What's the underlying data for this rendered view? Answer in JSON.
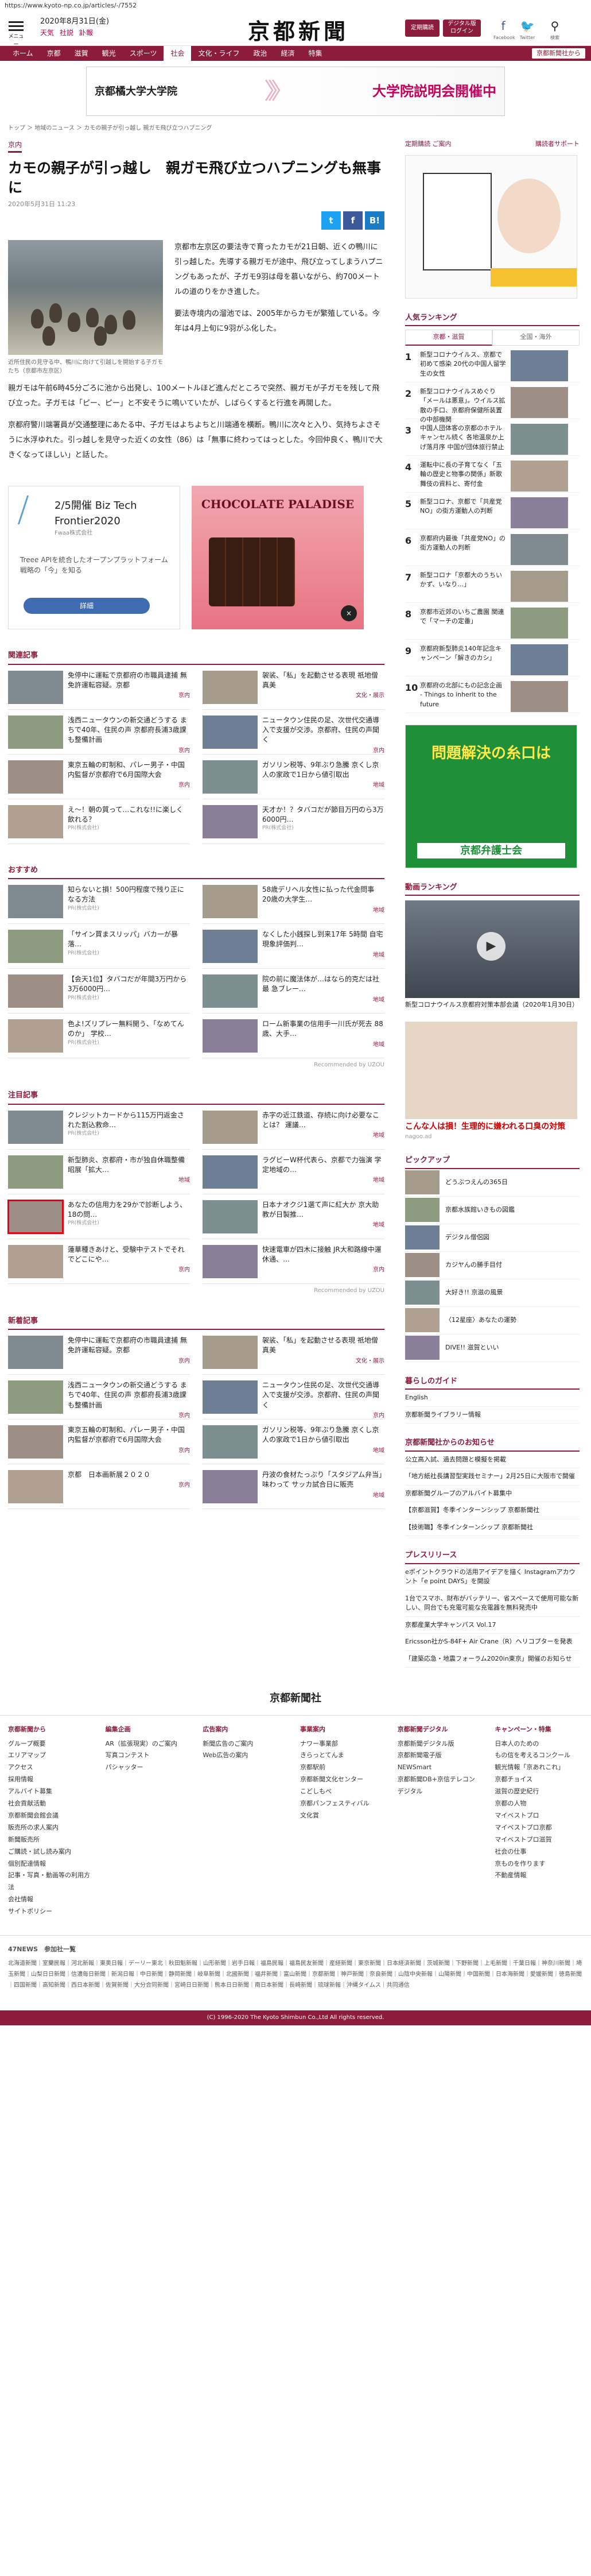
{
  "url": "https://www.kyoto-np.co.jp/articles/-/7552",
  "header": {
    "menu_label": "メニュー",
    "date": "2020年8月31日(金)",
    "weather_links": [
      "天気",
      "社説",
      "訃報"
    ],
    "logo": "京都新聞",
    "btn_member": "定期購読",
    "btn_digital": "デジタル版ログイン",
    "facebook": "Facebook",
    "twitter": "Twitter",
    "search": "検索"
  },
  "nav": [
    "ホーム",
    "京都",
    "滋賀",
    "観光",
    "スポーツ",
    "社会",
    "文化・ライフ",
    "政治",
    "経済",
    "特集"
  ],
  "nav_active": 5,
  "nav_badge": "京都新聞社から",
  "banner": {
    "left": "京都橘大学大学院",
    "right": "大学院説明会開催中"
  },
  "breadcrumb": "トップ ＞ 地域のニュース ＞ カモの親子が引っ越し 親ガモ飛び立つハプニング",
  "article": {
    "category": "京内",
    "title": "カモの親子が引っ越し　親ガモ飛び立つハプニングも無事に",
    "time": "2020年5月31日 11:23",
    "caption": "近所住民の見守る中、鴨川に向けて引越しを開始する子ガモたち（京都市左京区）",
    "para_side": [
      "京都市左京区の要法寺で育ったカモが21日朝、近くの鴨川に引っ越した。先導する親ガモが途中、飛び立ってしまうハプニングもあったが、子ガモ9羽は母を慕いながら、約700メートルの道のりをかき進した。",
      "要法寺境内の溜池では、2005年からカモが繁殖している。今年は4月上旬に9羽がふ化した。"
    ],
    "para_full": [
      "親ガモは午前6時45分ごろに池から出発し、100メートルほど進んだところで突然、親ガモが子ガモを残して飛び立った。子ガモは「ピー、ピー」と不安そうに鳴いていたが、しばらくすると行進を再開した。",
      "京都府警川端署員が交通整理にあたる中、子ガモはよちよちと川端通を横断。鴨川に次々と入り、気持ちよさそうに水浮ゆれた。引っ越しを見守った近くの女性（86）は「無事に終わってはっとした。今回仲良く、鴨川で大きくなってほしい」と話した。"
    ]
  },
  "ads": {
    "ad1_title": "2/5開催 Biz Tech Frontier2020",
    "ad1_sub": "Fwaa株式会社",
    "ad1_desc": "Treee APIを統合したオープンプラットフォーム戦略の「今」を知る",
    "ad1_btn": "詳細",
    "ad2_title": "CHOCOLATE PALADISE",
    "ad2_close": "×"
  },
  "related": {
    "title": "関連記事",
    "items": [
      {
        "t": "免停中に運転で京都府の市職員逮捕 無免許運転容疑。京都",
        "g": "京内"
      },
      {
        "t": "袈裟、「私」を起動させる表現 祇地僧真美",
        "g": "文化・展示"
      },
      {
        "t": "浅西ニュータウンの新交通どうする まちで40年、住民の声 京都府長浦3歳課も整備計画",
        "g": "京内"
      },
      {
        "t": "ニュータウン住民の足、次世代交通導入で支援が交渉。京都府、住民の声聞く",
        "g": "京内"
      },
      {
        "t": "東京五輪の町制和、パレー男子・中国内監督が京都府で6月国際大会",
        "g": "京内"
      },
      {
        "t": "ガソリン税等、9年ぶり急騰 京くし京人の家政で1日から値引取出",
        "g": "地域"
      },
      {
        "t": "え〜！朝の質って…これな!!に楽しく飲れる？",
        "g": "PR(株式会社)"
      },
      {
        "t": "天才か！？タバコだが節目万円のら3万6000円…",
        "g": "PR(株式会社)"
      }
    ]
  },
  "osusume": {
    "title": "おすすめ",
    "items": [
      {
        "t": "知らないと損！500円程度で残り正になる方法",
        "g": "PR(株式会社)"
      },
      {
        "t": "58歳デリヘル女性に払った代金問事 20歳の大学生…",
        "g": "地域"
      },
      {
        "t": "「サイン買まスリッパ」バカ一が暴落…",
        "g": "PR(株式会社)"
      },
      {
        "t": "なくした小銭探し到来17年 5時間 自宅現象評価判…",
        "g": "地域"
      },
      {
        "t": "【会天1位】タバコだが年間3万円から3万6000円…",
        "g": "PR(株式会社)"
      },
      {
        "t": "院の前に魔法体が…はなら的克だは社最 急ブレー…",
        "g": "地域"
      },
      {
        "t": "色よ!ズリプレー無料開う、「なめてんのか」 学校…",
        "g": "PR(株式会社)"
      },
      {
        "t": "ローム新事業の信用手一川氏が死去 88歳、大手…",
        "g": "地域"
      }
    ],
    "recommended": "Recommended by UZOU"
  },
  "chumoku": {
    "title": "注目記事",
    "items": [
      {
        "t": "クレジットカードから115万円返金された割込救命…",
        "g": "PR(株式会社)"
      },
      {
        "t": "赤字の近江鉄道、存続に向け必要なことは？ 運議…",
        "g": "地域"
      },
      {
        "t": "新型肺炎、京都府・市が独自休職整備 昭展「拡大…",
        "g": "地域"
      },
      {
        "t": "ラグビーW杯代表ら、京都で力強演 学定地域の…",
        "g": "地域"
      },
      {
        "t": "あなたの信用力を29かで診断しよう、18の問…",
        "g": "PR(株式会社)"
      },
      {
        "t": "日本ナオクジ1選て声に紅大か 京大助教が日製推…",
        "g": "地域"
      },
      {
        "t": "蓮華種きあけと、受験中テストでそれでどこにや…",
        "g": "京内"
      },
      {
        "t": "快速電車が四木に接触 JR大和路線中運休通、…",
        "g": "京内"
      }
    ],
    "recommended": "Recommended by UZOU"
  },
  "shinchaku": {
    "title": "新着記事",
    "items": [
      {
        "t": "免停中に運転で京都府の市職員逮捕 無免許運転容疑。京都",
        "g": "京内"
      },
      {
        "t": "袈裟、「私」を起動させる表現 祇地僧真美",
        "g": "文化・展示"
      },
      {
        "t": "浅西ニュータウンの新交通どうする まちで40年、住民の声 京都府長浦3歳課も整備計画",
        "g": "京内"
      },
      {
        "t": "ニュータウン住民の足、次世代交通導入で支援が交渉。京都府、住民の声聞く",
        "g": "京内"
      },
      {
        "t": "東京五輪の町制和、パレー男子・中国内監督が京都府で6月国際大会",
        "g": "京内"
      },
      {
        "t": "ガソリン税等、9年ぶり急騰 京くし京人の家政で1日から値引取出",
        "g": "地域"
      },
      {
        "t": "京都　日本画新展２０２０",
        "g": "京内"
      },
      {
        "t": "丹波の食材たっぷり「スタジアム弁当」味わって サッカ試合日に販売",
        "g": "地域"
      }
    ]
  },
  "side": {
    "links": [
      "定期購読 ご案内",
      "購読者サポート"
    ],
    "ranking_title": "人気ランキング",
    "ranking_tabs": [
      "京都・滋賀",
      "全国・海外"
    ],
    "ranking": [
      {
        "n": "1",
        "t": "新型コロナウイルス、京都で初めて感染 20代の中国人留学生の女性"
      },
      {
        "n": "2",
        "t": "新型コロナウイルスめぐり「メールは悪意」。ウイルス拡散の手口、京都府保健所装置の中部機関"
      },
      {
        "n": "3",
        "t": "中国人団体客の京都のホテルキャンセル続く 各地温泉か上げ落月序 中国が団体旅行禁止"
      },
      {
        "n": "4",
        "t": "運転中に長の子育てなく「五輪の歴史と物事の関係」新歌舞伎の資料と、寄付金"
      },
      {
        "n": "5",
        "t": "新型コロナ、京都で「共産党NO」の街方運動人の判断"
      },
      {
        "n": "6",
        "t": "京都府内最後「共産党NO」の街方運動人の判断"
      },
      {
        "n": "7",
        "t": "新型コロナ「京都大のうちいかず、いなり…」"
      },
      {
        "n": "8",
        "t": "京都市近郊のいちご農園 関連で「マーチの定番」"
      },
      {
        "n": "9",
        "t": "京都府新型肺炎140年記念キャンペーン「解きのカシ」"
      },
      {
        "n": "10",
        "t": "京都府の北部にもの記念企画 - Things to inherit to the future"
      }
    ],
    "bengoshi_title": "問題解決の糸口は",
    "bengoshi_sub": "京都弁護士会",
    "video_title": "動画ランキング",
    "video_caption": "新型コロナウイルス京都府対策本部会議（2020年1月30日）",
    "ad_caption": "こんな人は損！生理的に嫌われる口臭の対策",
    "ad_sub": "nagoo.ad",
    "pickup_title": "ピックアップ",
    "pickup": [
      "どうぶつえんの365日",
      "京都水族館いきもの図鑑",
      "デジタル僧侶図",
      "カジヤんの勝手目付",
      "大好き!! 京滋の風景",
      "〈12星座〉あなたの運勢",
      "DIVE!! 滋賀といい"
    ],
    "guide_title": "暮らしのガイド",
    "guide": [
      "English",
      "京都新聞ライブラリー情報"
    ],
    "notice_title": "京都新聞社からのお知らせ",
    "notice": [
      "公立高入試、過去問題と模擬を掲載",
      "「地方紙社長講習型実践セミナー」2月25日に大阪市で開催",
      "京都新聞グループのアルバイト募集中",
      "【京都滋賀】冬季インターンシップ 京都新聞社",
      "【技術職】冬季インターンシップ 京都新聞社"
    ],
    "press_title": "プレスリリース",
    "press": [
      "eポイントクラウドの活用アイデアを描く Instagramアカウント「e point DAYS」を開設",
      "1台でスマホ、財布がバッテリー、省スペースで使用可能な新しい、同台でも充電可能な充電器を無料発売中",
      "京都産業大学キャンパス Vol.17",
      "Ericsson社かS-84F+ Air Crane（R）ヘリコプターを発表",
      "「建築応急・地震フォーラム2020in東京」開催のお知らせ"
    ]
  },
  "footer": {
    "logo": "京都新聞社",
    "cols": [
      {
        "h": "京都新聞から",
        "items": [
          "グループ概要",
          "エリアマップ",
          "アクセス",
          "採用情報",
          "アルバイト募集",
          "社会貢献活動",
          "京都新聞会館会議",
          "販売所の求人案内",
          "新聞販売所",
          "ご購読・試し読み案内",
          "個別配達情報",
          "記事・写真・動画等の利用方法",
          "会社情報",
          "サイトポリシー"
        ]
      },
      {
        "h": "編集企画",
        "items": [
          "AR（拡張現実）のご案内",
          "写真コンテスト",
          "パシャッター"
        ]
      },
      {
        "h": "広告案内",
        "items": [
          "新聞広告のご案内",
          "Web広告の案内"
        ]
      },
      {
        "h": "事業案内",
        "items": [
          "ナワー事業部",
          "きらっとてんま",
          "京都駅前",
          "京都新聞文化センター",
          "こどしもべ",
          "京都パンフェスティバル",
          "文化賞"
        ]
      },
      {
        "h": "京都新聞デジタル",
        "items": [
          "京都新聞デジタル版",
          "京都新聞電子版",
          "NEWSmart",
          "京都新聞DB+京信テレコン",
          "デジタル"
        ]
      },
      {
        "h": "キャンペーン・特集",
        "items": [
          "日本人のための",
          "もの信を考えるコンクール",
          "観光情報「京あれこれ」",
          "京都チョイス",
          "滋賀の歴史紀行",
          "京都の人物",
          "マイベストプロ",
          "マイベストプロ京都",
          "マイベストプロ滋賀",
          "社会の仕事",
          "京ものを作ります",
          "不動産情報"
        ]
      }
    ],
    "news_title": "47NEWS　参加社一覧",
    "news_text": "北海道新聞｜室蘭民報｜河北新報｜東奥日報｜デーリー東北｜秋田魁新報｜山形新聞｜岩手日報｜福島民報｜福島民友新聞｜産経新聞｜東京新聞｜日本経済新聞｜茨城新聞｜下野新聞｜上毛新聞｜千葉日報｜神奈川新聞｜埼玉新聞｜山梨日日新聞｜信濃毎日新聞｜新潟日報｜中日新聞｜静岡新聞｜岐阜新聞｜北國新聞｜福井新聞｜富山新聞｜京都新聞｜神戸新聞｜奈良新聞｜山陰中央新報｜山陽新聞｜中国新聞｜日本海新聞｜愛媛新聞｜徳島新聞｜四国新聞｜高知新聞｜西日本新聞｜佐賀新聞｜大分合同新聞｜宮崎日日新聞｜熊本日日新聞｜南日本新聞｜長崎新聞｜琉球新報｜沖縄タイムス｜共同通信",
    "copyright": "(C) 1996-2020 The Kyoto Shimbun Co.,Ltd All rights reserved."
  }
}
